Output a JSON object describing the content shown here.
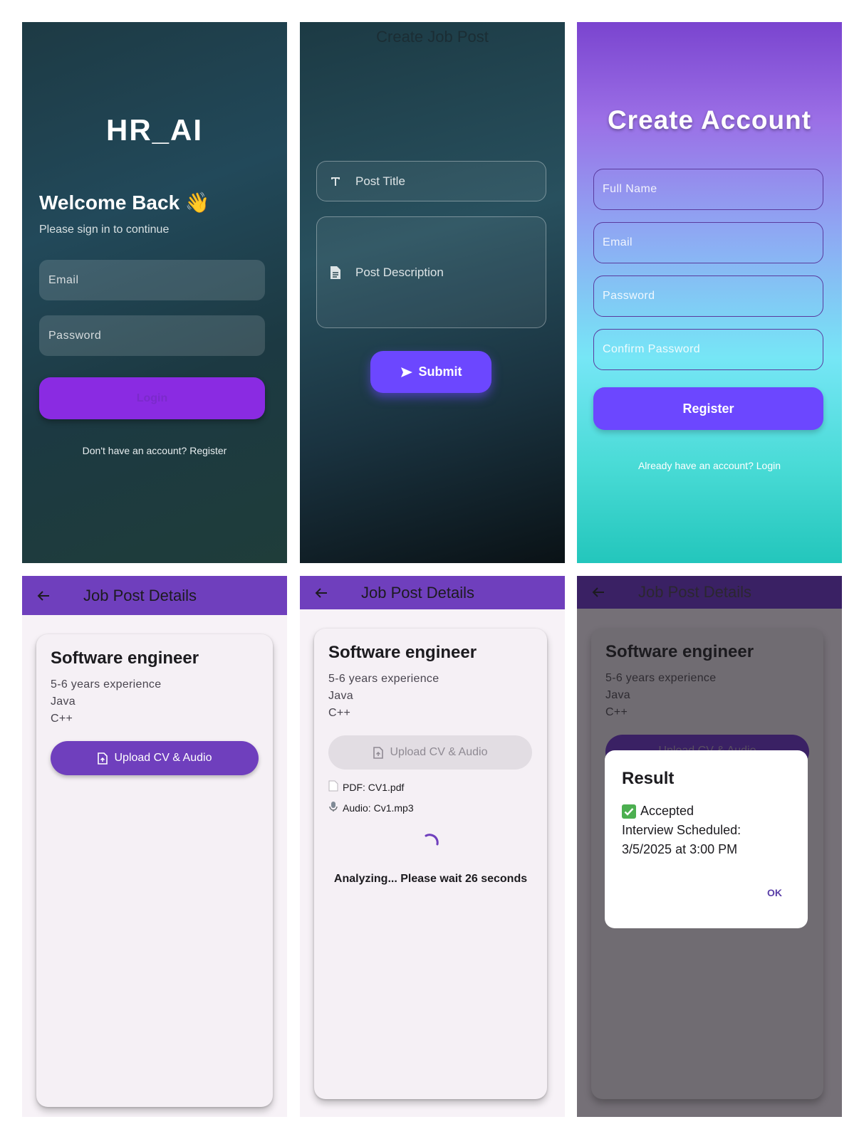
{
  "login": {
    "app_title": "HR_AI",
    "welcome": "Welcome Back 👋",
    "subtitle": "Please sign in to continue",
    "email_placeholder": "Email",
    "password_placeholder": "Password",
    "login_button": "Login",
    "register_link": "Don't have an account? Register"
  },
  "create_post": {
    "title": "Create Job Post",
    "post_title_placeholder": "Post Title",
    "post_description_placeholder": "Post Description",
    "submit_button": "Submit"
  },
  "register": {
    "title": "Create Account",
    "full_name_placeholder": "Full Name",
    "email_placeholder": "Email",
    "password_placeholder": "Password",
    "confirm_password_placeholder": "Confirm Password",
    "register_button": "Register",
    "login_link": "Already have an account? Login"
  },
  "details_idle": {
    "appbar_title": "Job Post Details",
    "job_title": "Software engineer",
    "lines": [
      "5-6 years experience",
      "Java",
      "C++"
    ],
    "upload_button": "Upload CV & Audio"
  },
  "details_analyzing": {
    "appbar_title": "Job Post Details",
    "job_title": "Software engineer",
    "lines": [
      "5-6 years experience",
      "Java",
      "C++"
    ],
    "upload_button": "Upload CV & Audio",
    "pdf_file": "PDF: CV1.pdf",
    "audio_file": "Audio: Cv1.mp3",
    "status": "Analyzing... Please wait 26 seconds"
  },
  "details_result": {
    "appbar_title": "Job Post Details",
    "job_title": "Software engineer",
    "lines": [
      "5-6 years experience",
      "Java",
      "C++"
    ],
    "upload_button": "Upload CV & Audio",
    "dialog": {
      "title": "Result",
      "status": "Accepted",
      "line1": "Interview Scheduled:",
      "line2": "3/5/2025 at 3:00 PM",
      "ok_button": "OK"
    }
  },
  "colors": {
    "primary_purple": "#6f3fbd",
    "button_violet": "#6c47ff",
    "login_button": "#8a2be2"
  },
  "icons": [
    "text-title-icon",
    "document-icon",
    "send-icon",
    "back-arrow-icon",
    "upload-file-icon",
    "pdf-icon",
    "microphone-icon",
    "check-mark-icon",
    "spinner-icon"
  ]
}
